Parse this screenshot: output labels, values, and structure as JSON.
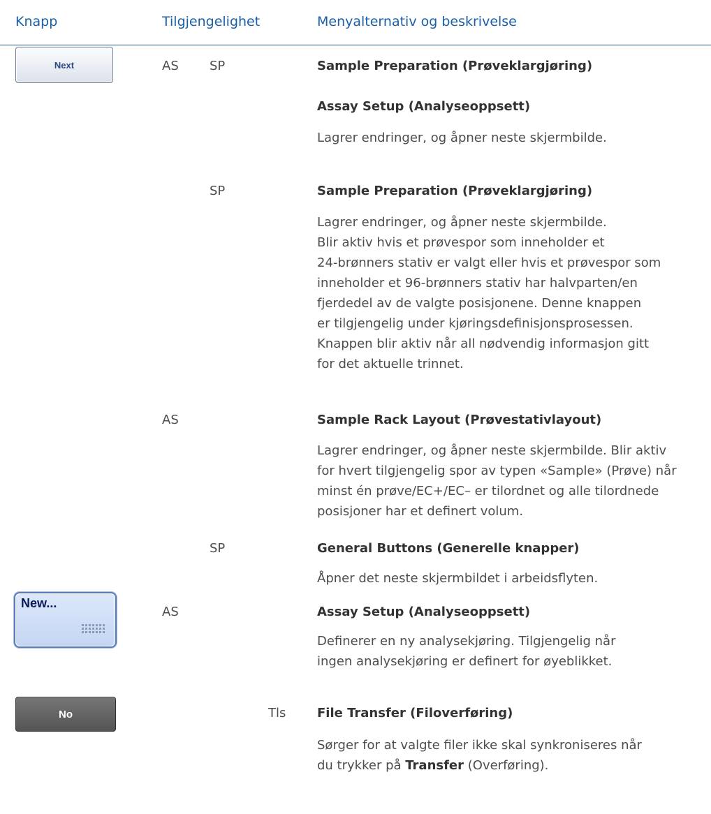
{
  "header": {
    "col1": "Knapp",
    "col2": "Tilgjengelighet",
    "col3": "Menyalternativ og beskrivelse"
  },
  "buttons": {
    "next": "Next",
    "new": "New...",
    "no": "No"
  },
  "rows": {
    "r1": {
      "avail1": "AS",
      "avail2": "SP",
      "heading": "Sample Preparation (Prøveklargjøring)",
      "heading2": "Assay Setup (Analyseoppsett)",
      "desc": "Lagrer endringer, og åpner neste skjermbilde."
    },
    "r2": {
      "avail": "SP",
      "heading": "Sample Preparation (Prøveklargjøring)",
      "lines": [
        "Lagrer endringer, og åpner neste skjermbilde.",
        "Blir aktiv hvis et prøvespor som inneholder et",
        "24-brønners stativ er valgt eller hvis et prøvespor som",
        "inneholder et 96-brønners stativ har halvparten/en",
        "fjerdedel av de valgte posisjonene. Denne knappen",
        "er tilgjengelig under kjøringsdefinisjonsprosessen.",
        "Knappen blir aktiv når all nødvendig informasjon gitt",
        "for det aktuelle trinnet."
      ]
    },
    "r3": {
      "avail": "AS",
      "heading": "Sample Rack Layout (Prøvestativlayout)",
      "lines": [
        "Lagrer endringer, og åpner neste skjermbilde. Blir aktiv",
        "for hvert tilgjengelig spor av typen «Sample» (Prøve) når",
        "minst én prøve/EC+/EC– er tilordnet og alle tilordnede",
        "posisjoner har et definert volum."
      ]
    },
    "r4": {
      "avail": "SP",
      "heading": "General Buttons (Generelle knapper)",
      "desc": "Åpner det neste skjermbildet i arbeidsflyten."
    },
    "r5": {
      "avail": "AS",
      "heading": "Assay Setup (Analyseoppsett)",
      "lines": [
        "Definerer en ny analysekjøring. Tilgjengelig når",
        "ingen analysekjøring er definert for øyeblikket."
      ]
    },
    "r6": {
      "avail": "Tls",
      "heading": "File Transfer (Filoverføring)",
      "line1": "Sørger for at valgte filer ikke skal synkroniseres når",
      "line2_pre": "du trykker på ",
      "line2_bold": "Transfer",
      "line2_post": " (Overføring)."
    }
  }
}
